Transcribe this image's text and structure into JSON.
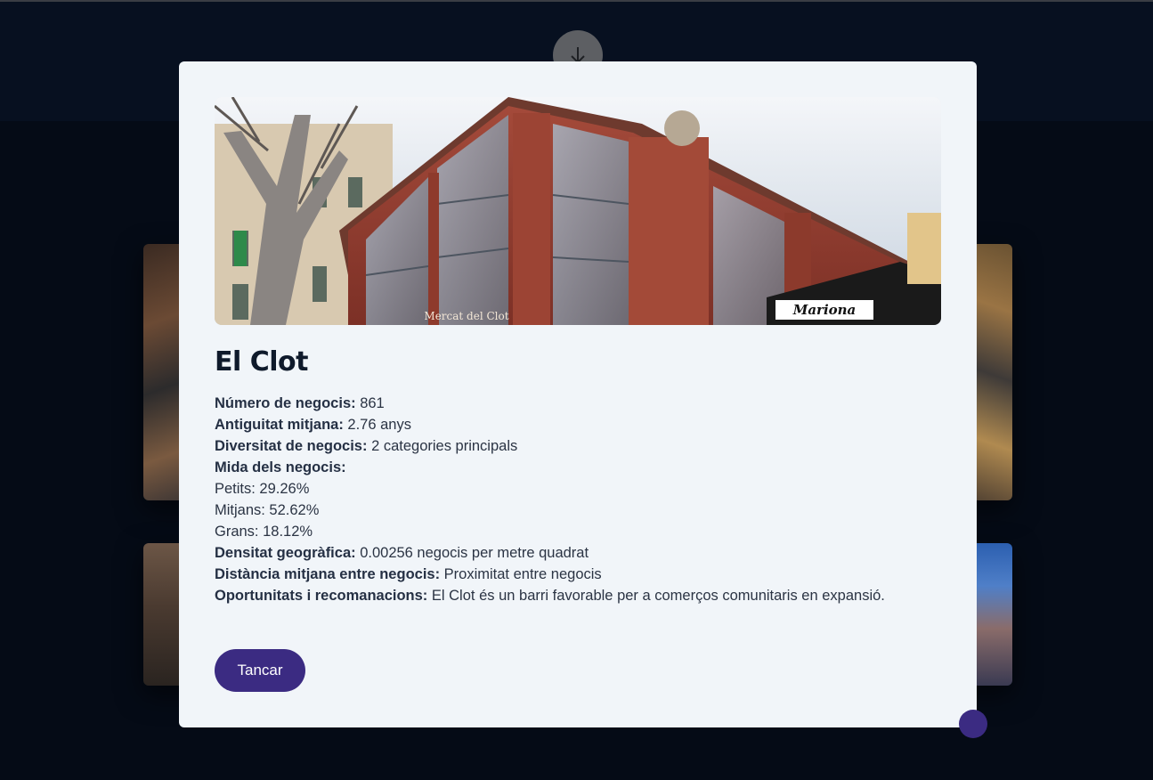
{
  "modal": {
    "title": "El Clot",
    "details": [
      {
        "label": "Número de negocis:",
        "value": " 861"
      },
      {
        "label": "Antiguitat mitjana:",
        "value": " 2.76 anys"
      },
      {
        "label": "Diversitat de negocis:",
        "value": " 2 categories principals"
      },
      {
        "label": "Mida dels negocis:",
        "value": ""
      }
    ],
    "sizes": [
      "Petits: 29.26%",
      "Mitjans: 52.62%",
      "Grans: 18.12%"
    ],
    "extra": [
      {
        "label": "Densitat geogràfica:",
        "value": " 0.00256 negocis per metre quadrat"
      },
      {
        "label": "Distància mitjana entre negocis:",
        "value": " Proximitat entre negocis"
      },
      {
        "label": "Oportunitats i recomanacions:",
        "value": " El Clot és un barri favorable per a comerços comunitaris en expansió."
      }
    ],
    "close_label": "Tancar",
    "image": {
      "sign_market": "Mercat del Clot",
      "sign_shop": "Mariona"
    }
  },
  "icons": {
    "scroll": "arrow-down-icon"
  },
  "colors": {
    "background": "#050b16",
    "modal": "#f1f5f9",
    "accent": "#3b2b82",
    "title": "#0f1a2b"
  }
}
